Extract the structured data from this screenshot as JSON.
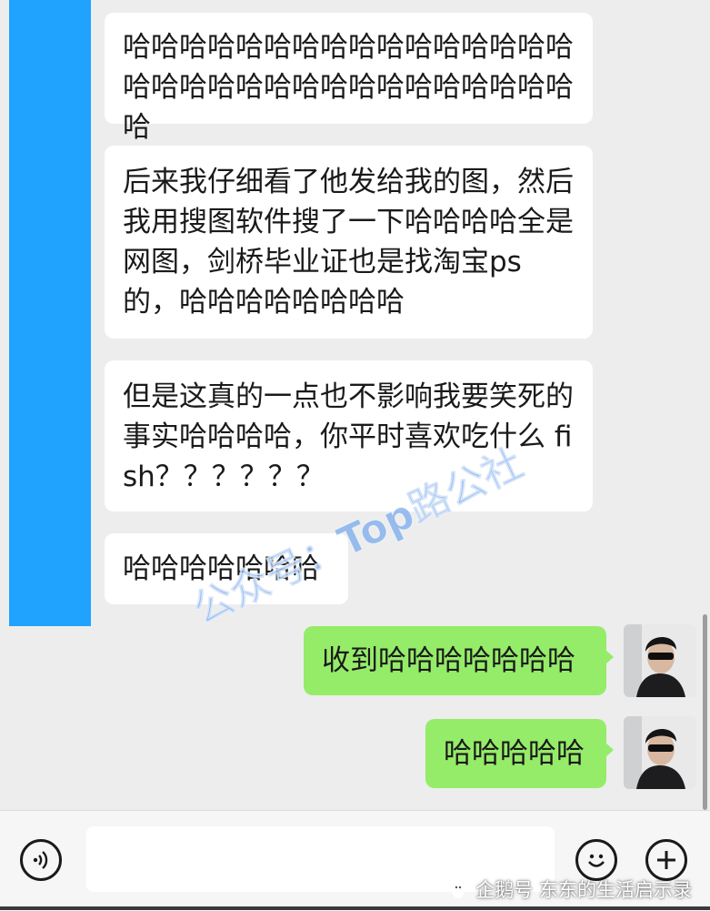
{
  "messages": {
    "m1": "哈哈哈哈哈哈哈哈哈哈哈哈哈哈哈哈哈哈哈哈哈哈哈哈哈哈哈哈哈哈哈哈哈",
    "m2": "后来我仔细看了他发给我的图，然后我用搜图软件搜了一下哈哈哈哈全是网图，剑桥毕业证也是找淘宝ps 的，哈哈哈哈哈哈哈哈",
    "m3": "但是这真的一点也不影响我要笑死的事实哈哈哈哈，你平时喜欢吃什么 fish？？？？？？",
    "m4": "哈哈哈哈哈哈哈",
    "m5": "收到哈哈哈哈哈哈哈",
    "m6": "哈哈哈哈哈"
  },
  "watermark": "公众号：Top路公社",
  "credit": "企鹅号 东东的生活启示录",
  "input_bar": {
    "voice_icon": "voice-icon",
    "emoji_icon": "emoji-icon",
    "plus_icon": "plus-icon"
  },
  "colors": {
    "background": "#ededed",
    "incoming_bubble": "#ffffff",
    "outgoing_bubble": "#95ec69",
    "avatar_cover": "#1fa3ff"
  }
}
